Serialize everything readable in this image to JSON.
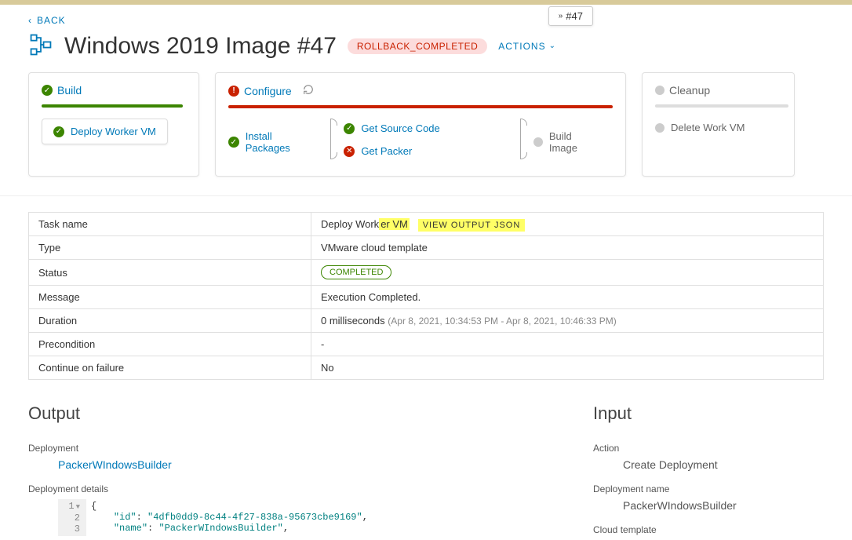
{
  "tab_marker": "#47",
  "back_label": "BACK",
  "title": "Windows 2019 Image #47",
  "rollback_status": "ROLLBACK_COMPLETED",
  "actions_label": "ACTIONS",
  "stages": {
    "build": {
      "title": "Build",
      "task": "Deploy Worker VM"
    },
    "configure": {
      "title": "Configure",
      "install": "Install Packages",
      "get_source": "Get Source Code",
      "get_packer": "Get Packer",
      "build_image": "Build Image"
    },
    "cleanup": {
      "title": "Cleanup",
      "delete": "Delete Work VM"
    }
  },
  "details": {
    "rows": {
      "task_name_label": "Task name",
      "task_name_value": "Deploy Worker VM",
      "view_json": "VIEW OUTPUT JSON",
      "type_label": "Type",
      "type_value": "VMware cloud template",
      "status_label": "Status",
      "status_value": "COMPLETED",
      "message_label": "Message",
      "message_value": "Execution Completed.",
      "duration_label": "Duration",
      "duration_value": "0 milliseconds",
      "duration_range": "(Apr 8, 2021, 10:34:53 PM - Apr 8, 2021, 10:46:33 PM)",
      "precondition_label": "Precondition",
      "precondition_value": "-",
      "continue_label": "Continue on failure",
      "continue_value": "No"
    }
  },
  "output": {
    "heading": "Output",
    "deployment_label": "Deployment",
    "deployment_value": "PackerWIndowsBuilder",
    "details_label": "Deployment details",
    "code": {
      "l1": "{",
      "l2_k": "\"id\"",
      "l2_v": "\"4dfb0dd9-8c44-4f27-838a-95673cbe9169\"",
      "l3_k": "\"name\"",
      "l3_v": "\"PackerWIndowsBuilder\""
    }
  },
  "input": {
    "heading": "Input",
    "action_label": "Action",
    "action_value": "Create Deployment",
    "depname_label": "Deployment name",
    "depname_value": "PackerWIndowsBuilder",
    "cloud_label": "Cloud template"
  }
}
